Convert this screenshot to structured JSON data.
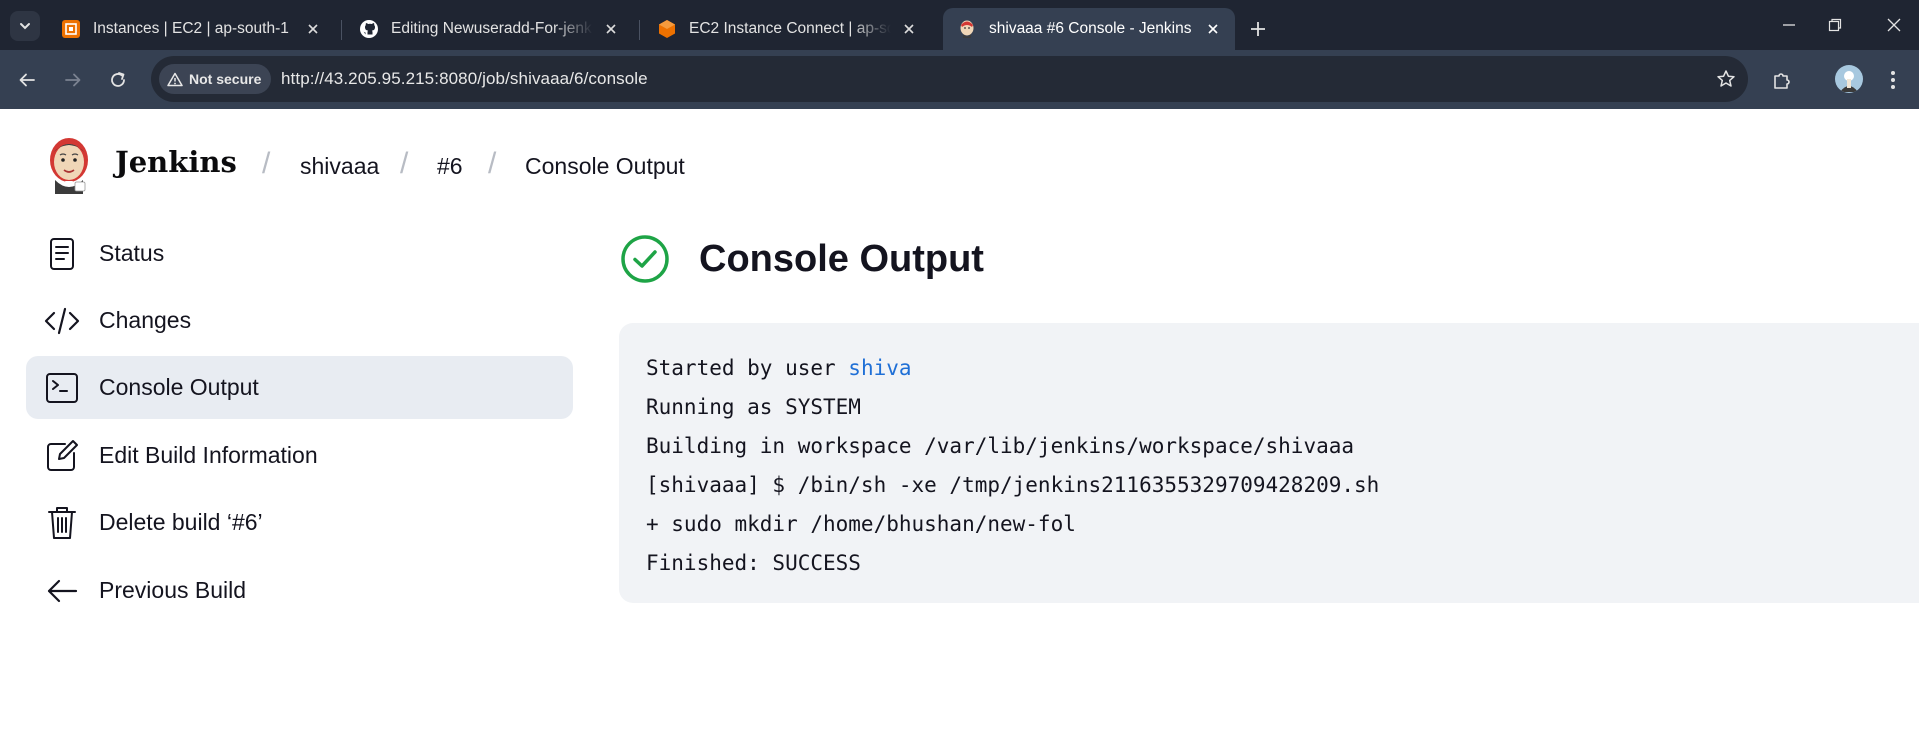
{
  "browser": {
    "tabs": [
      {
        "title": "Instances | EC2 | ap-south-1",
        "icon": "aws-ec2-icon",
        "active": false
      },
      {
        "title": "Editing Newuseradd-For-jenkins",
        "icon": "github-icon",
        "active": false
      },
      {
        "title": "EC2 Instance Connect | ap-south-1",
        "icon": "aws-connect-icon",
        "active": false
      },
      {
        "title": "shivaaa #6 Console - Jenkins",
        "icon": "jenkins-icon",
        "active": true
      }
    ],
    "security_label": "Not secure",
    "url": "http://43.205.95.215:8080/job/shivaaa/6/console",
    "colors": {
      "tabstrip": "#1f2532",
      "toolbar": "#354052",
      "omnibox": "#242a36"
    }
  },
  "header": {
    "brand": "Jenkins",
    "breadcrumbs": [
      "shivaaa",
      "#6",
      "Console Output"
    ]
  },
  "sidebar": {
    "items": [
      {
        "label": "Status",
        "icon": "document-icon",
        "active": false
      },
      {
        "label": "Changes",
        "icon": "code-icon",
        "active": false
      },
      {
        "label": "Console Output",
        "icon": "terminal-icon",
        "active": true
      },
      {
        "label": "Edit Build Information",
        "icon": "edit-icon",
        "active": false
      },
      {
        "label": "Delete build ‘#6’",
        "icon": "trash-icon",
        "active": false
      },
      {
        "label": "Previous Build",
        "icon": "arrow-left-icon",
        "active": false
      }
    ]
  },
  "main": {
    "title": "Console Output",
    "status": "success",
    "status_color": "#1ea446",
    "console": {
      "started_prefix": "Started by user ",
      "user": "shiva",
      "lines": [
        "Running as SYSTEM",
        "Building in workspace /var/lib/jenkins/workspace/shivaaa",
        "[shivaaa] $ /bin/sh -xe /tmp/jenkins2116355329709428209.sh",
        "+ sudo mkdir /home/bhushan/new-fol",
        "Finished: SUCCESS"
      ]
    }
  }
}
